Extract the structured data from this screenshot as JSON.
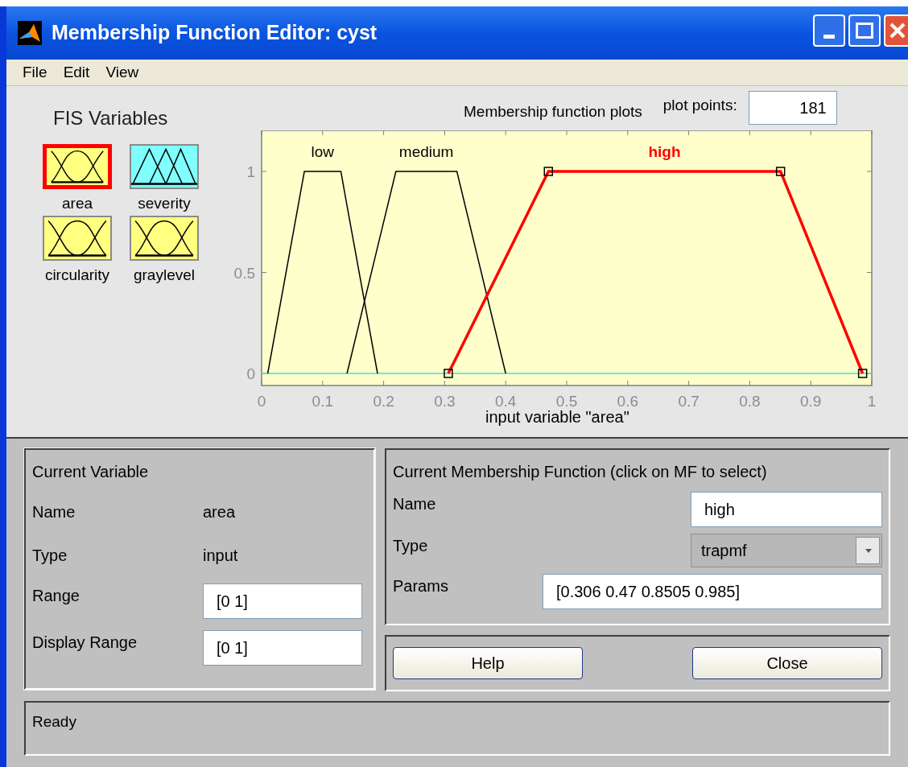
{
  "window": {
    "title": "Membership Function Editor: cyst"
  },
  "menu": [
    "File",
    "Edit",
    "View"
  ],
  "fis_variables": {
    "title": "FIS Variables",
    "items": [
      {
        "name": "area",
        "kind": "input",
        "selected": true
      },
      {
        "name": "severity",
        "kind": "output",
        "selected": false
      },
      {
        "name": "circularity",
        "kind": "input",
        "selected": false
      },
      {
        "name": "graylevel",
        "kind": "input",
        "selected": false
      }
    ]
  },
  "plot": {
    "plot_points_label": "plot points:",
    "plot_points": "181",
    "curve_selection": [
      {
        "selected": false
      },
      {
        "selected": false
      },
      {
        "selected": true
      }
    ],
    "chart_data": {
      "type": "line",
      "title": "Membership function plots",
      "xlabel": "input variable \"area\"",
      "x": [
        0.01,
        0.07,
        0.13,
        0.14,
        0.19,
        0.22,
        0.306,
        0.32,
        0.4,
        0.47,
        0.8505,
        0.985
      ],
      "series": [
        {
          "name": "low",
          "values": [
            0,
            1,
            1,
            0.83,
            0,
            null,
            null,
            null,
            null,
            null,
            null,
            null
          ]
        },
        {
          "name": "medium",
          "values": [
            null,
            null,
            null,
            0,
            0.625,
            1,
            1,
            1,
            0,
            null,
            null,
            null
          ]
        },
        {
          "name": "high",
          "values": [
            null,
            null,
            null,
            null,
            null,
            null,
            0,
            0.085,
            0.573,
            1,
            1,
            0
          ]
        }
      ],
      "xlim": [
        0,
        1
      ],
      "ylim": [
        0,
        1.2
      ],
      "xticks": [
        0,
        0.1,
        0.2,
        0.3,
        0.4,
        0.5,
        0.6,
        0.7,
        0.8,
        0.9,
        1
      ],
      "yticks": [
        {
          "value": 0,
          "label": "0"
        },
        {
          "value": 0.5,
          "label": "0.5"
        },
        {
          "value": 1,
          "label": "1"
        }
      ]
    }
  },
  "current_variable": {
    "title": "Current Variable",
    "name_label": "Name",
    "name": "area",
    "type_label": "Type",
    "type": "input",
    "range_label": "Range",
    "range": "[0 1]",
    "display_range_label": "Display Range",
    "display_range": "[0 1]"
  },
  "current_mf": {
    "title": "Current Membership Function (click on MF to select)",
    "name_label": "Name",
    "name": "high",
    "type_label": "Type",
    "type": "trapmf",
    "params_label": "Params",
    "params": "[0.306 0.47 0.8505 0.985]"
  },
  "buttons": [
    "Help",
    "Close"
  ],
  "status": "Ready"
}
